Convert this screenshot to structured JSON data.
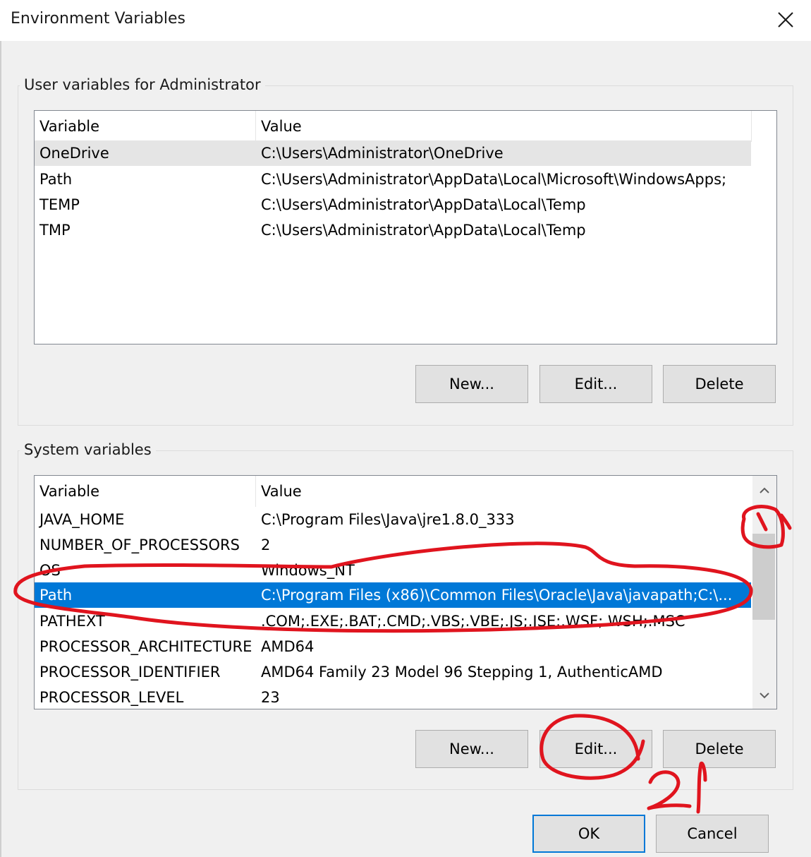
{
  "window": {
    "title": "Environment Variables",
    "close_icon": "close-icon"
  },
  "user_vars": {
    "group_label": "User variables for Administrator",
    "columns": {
      "variable": "Variable",
      "value": "Value"
    },
    "rows": [
      {
        "variable": "OneDrive",
        "value": "C:\\Users\\Administrator\\OneDrive"
      },
      {
        "variable": "Path",
        "value": "C:\\Users\\Administrator\\AppData\\Local\\Microsoft\\WindowsApps;"
      },
      {
        "variable": "TEMP",
        "value": "C:\\Users\\Administrator\\AppData\\Local\\Temp"
      },
      {
        "variable": "TMP",
        "value": "C:\\Users\\Administrator\\AppData\\Local\\Temp"
      }
    ],
    "buttons": {
      "new": "New...",
      "edit": "Edit...",
      "delete": "Delete"
    }
  },
  "system_vars": {
    "group_label": "System variables",
    "columns": {
      "variable": "Variable",
      "value": "Value"
    },
    "rows": [
      {
        "variable": "JAVA_HOME",
        "value": "C:\\Program Files\\Java\\jre1.8.0_333"
      },
      {
        "variable": "NUMBER_OF_PROCESSORS",
        "value": "2"
      },
      {
        "variable": "OS",
        "value": "Windows_NT"
      },
      {
        "variable": "Path",
        "value": "C:\\Program Files (x86)\\Common Files\\Oracle\\Java\\javapath;C:\\..."
      },
      {
        "variable": "PATHEXT",
        "value": ".COM;.EXE;.BAT;.CMD;.VBS;.VBE;.JS;.JSE;.WSF;.WSH;.MSC"
      },
      {
        "variable": "PROCESSOR_ARCHITECTURE",
        "value": "AMD64"
      },
      {
        "variable": "PROCESSOR_IDENTIFIER",
        "value": "AMD64 Family 23 Model 96 Stepping 1, AuthenticAMD"
      },
      {
        "variable": "PROCESSOR_LEVEL",
        "value": "23"
      }
    ],
    "selected_index": 3,
    "buttons": {
      "new": "New...",
      "edit": "Edit...",
      "delete": "Delete"
    }
  },
  "footer": {
    "ok": "OK",
    "cancel": "Cancel"
  },
  "annotations": {
    "color": "#e0141e",
    "marks": [
      "1",
      "2"
    ]
  },
  "colors": {
    "selection": "#0078d7",
    "hover": "#e5e5e5",
    "button_face": "#e1e1e1"
  }
}
